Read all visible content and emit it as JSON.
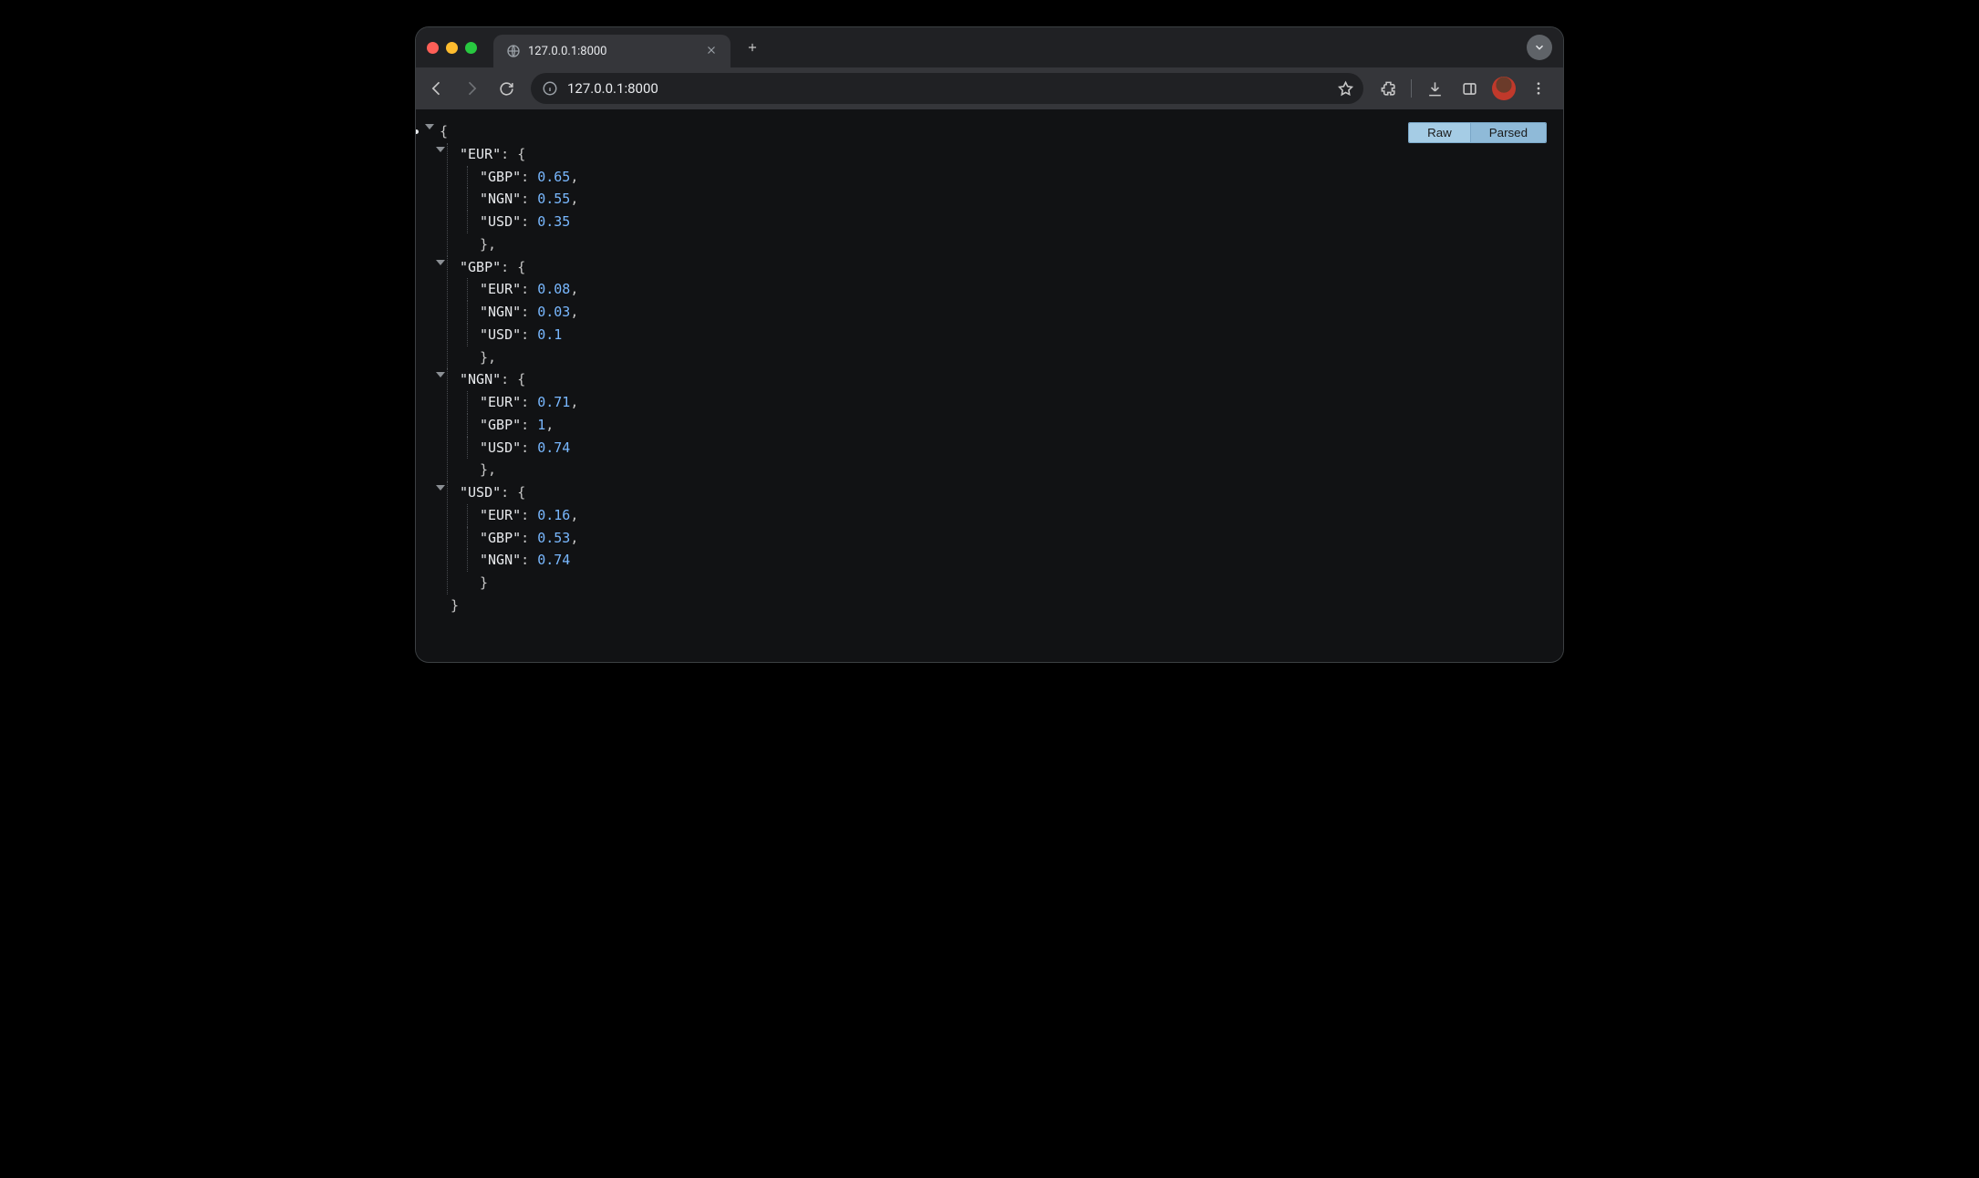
{
  "tab": {
    "title": "127.0.0.1:8000"
  },
  "addressbar": {
    "url": "127.0.0.1:8000"
  },
  "viewer": {
    "buttons": {
      "raw": "Raw",
      "parsed": "Parsed"
    }
  },
  "json": {
    "EUR": {
      "GBP": 0.65,
      "NGN": 0.55,
      "USD": 0.35
    },
    "GBP": {
      "EUR": 0.08,
      "NGN": 0.03,
      "USD": 0.1
    },
    "NGN": {
      "EUR": 0.71,
      "GBP": 1,
      "USD": 0.74
    },
    "USD": {
      "EUR": 0.16,
      "GBP": 0.53,
      "NGN": 0.74
    }
  }
}
